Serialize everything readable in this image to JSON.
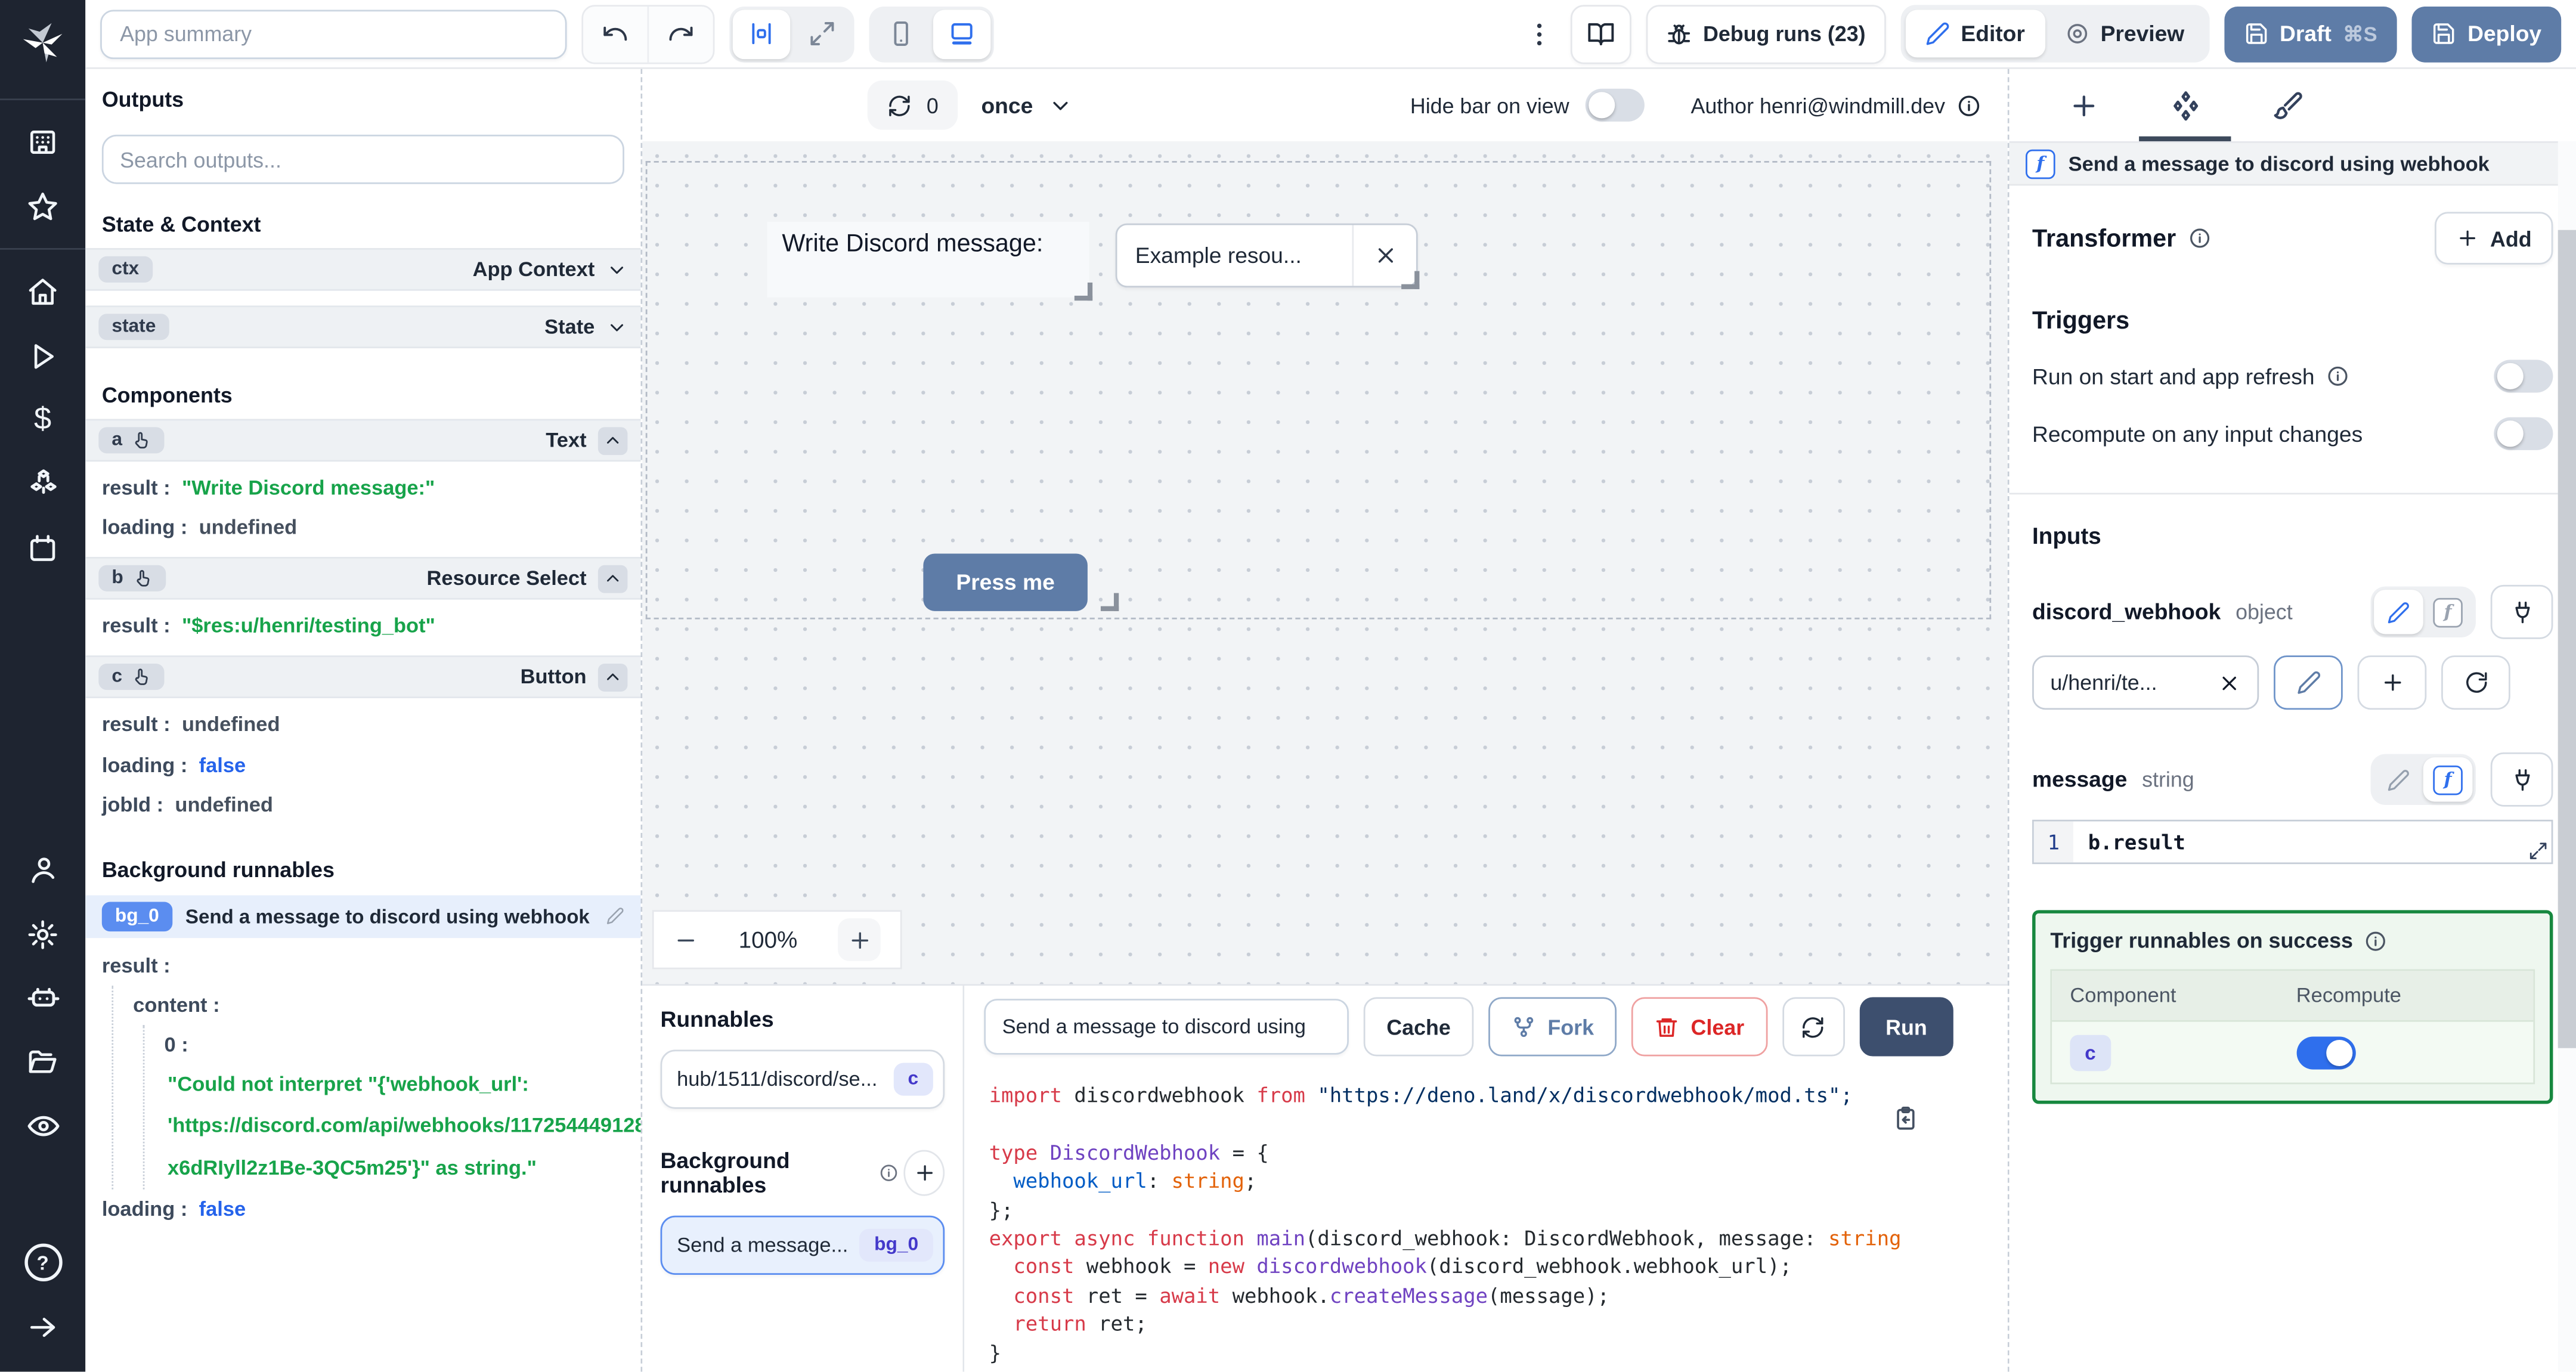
{
  "topbar": {
    "app_summary_placeholder": "App summary",
    "debug_runs_label": "Debug runs (23)",
    "editor_label": "Editor",
    "preview_label": "Preview",
    "draft_label": "Draft",
    "draft_shortcut": "⌘S",
    "deploy_label": "Deploy"
  },
  "rail_icons": {
    "dollar_glyph": "$",
    "help_glyph": "?"
  },
  "canvas_bar": {
    "refresh_count": "0",
    "refresh_mode": "once",
    "hide_bar_label": "Hide bar on view",
    "author_label": "Author henri@windmill.dev"
  },
  "outputs": {
    "title": "Outputs",
    "search_placeholder": "Search outputs...",
    "state_context_title": "State & Context",
    "ctx": {
      "id": "ctx",
      "type": "App Context"
    },
    "state": {
      "id": "state",
      "type": "State"
    },
    "components_title": "Components",
    "a": {
      "id": "a",
      "type": "Text",
      "result_key": "result",
      "result": "\"Write Discord message:\"",
      "loading_key": "loading",
      "loading": "undefined"
    },
    "b": {
      "id": "b",
      "type": "Resource Select",
      "result_key": "result",
      "result": "\"$res:u/henri/testing_bot\""
    },
    "c": {
      "id": "c",
      "type": "Button",
      "result_key": "result",
      "result": "undefined",
      "loading_key": "loading",
      "loading": "false",
      "jobid_key": "jobId",
      "jobid": "undefined"
    },
    "background_title": "Background runnables",
    "bg": {
      "id": "bg_0",
      "name": "Send a message to discord using webhook",
      "result_key": "result",
      "content_key": "content",
      "index_key": "0",
      "error_line1": "\"Could not interpret \"{'webhook_url':",
      "error_line2": "'https://discord.com/api/webhooks/117254449128",
      "error_line3": "x6dRIyll2z1Be-3QC5m25'}\" as string.\"",
      "loading_key": "loading",
      "loading": "false"
    }
  },
  "canvas": {
    "text_component": "Write Discord message:",
    "select_value": "Example resou...",
    "button_label": "Press me",
    "zoom_level": "100%"
  },
  "runnables": {
    "title": "Runnables",
    "item_path": "hub/1511/discord/se...",
    "item_badge": "c",
    "background_title": "Background runnables",
    "bg_item_name": "Send a message...",
    "bg_item_badge": "bg_0"
  },
  "editor": {
    "name_value": "Send a message to discord using",
    "cache_label": "Cache",
    "fork_label": "Fork",
    "clear_label": "Clear",
    "run_label": "Run",
    "code": {
      "lines": [
        [
          [
            "import",
            "kw"
          ],
          [
            " discordwebhook ",
            "pl"
          ],
          [
            "from",
            "kw"
          ],
          [
            " ",
            "pl"
          ],
          [
            "\"https://deno.land/x/discordwebhook/mod.ts\";",
            "str"
          ]
        ],
        [],
        [
          [
            "type",
            "kw"
          ],
          [
            " ",
            "pl"
          ],
          [
            "DiscordWebhook",
            "type"
          ],
          [
            " = {",
            "pl"
          ]
        ],
        [
          [
            "  ",
            "pl"
          ],
          [
            "webhook_url",
            "prop"
          ],
          [
            ": ",
            "pl"
          ],
          [
            "string",
            "orn"
          ],
          [
            ";",
            "pl"
          ]
        ],
        [
          [
            "};",
            "pl"
          ]
        ],
        [
          [
            "export",
            "kw"
          ],
          [
            " ",
            "pl"
          ],
          [
            "async",
            "kw"
          ],
          [
            " ",
            "pl"
          ],
          [
            "function",
            "kw"
          ],
          [
            " ",
            "pl"
          ],
          [
            "main",
            "fn"
          ],
          [
            "(discord_webhook: DiscordWebhook, message: ",
            "pl"
          ],
          [
            "string",
            "orn"
          ]
        ],
        [
          [
            "  ",
            "pl"
          ],
          [
            "const",
            "kw"
          ],
          [
            " webhook = ",
            "pl"
          ],
          [
            "new",
            "kw"
          ],
          [
            " ",
            "pl"
          ],
          [
            "discordwebhook",
            "fn"
          ],
          [
            "(discord_webhook.webhook_url);",
            "pl"
          ]
        ],
        [
          [
            "  ",
            "pl"
          ],
          [
            "const",
            "kw"
          ],
          [
            " ret = ",
            "pl"
          ],
          [
            "await",
            "kw"
          ],
          [
            " webhook.",
            "pl"
          ],
          [
            "createMessage",
            "fn"
          ],
          [
            "(message);",
            "pl"
          ]
        ],
        [
          [
            "  ",
            "pl"
          ],
          [
            "return",
            "kw"
          ],
          [
            " ret;",
            "pl"
          ]
        ],
        [
          [
            "}",
            "pl"
          ]
        ]
      ]
    }
  },
  "right_panel": {
    "header_title": "Send a message to discord using webhook",
    "f_glyph": "f",
    "transformer_title": "Transformer",
    "add_label": "Add",
    "triggers_title": "Triggers",
    "trigger_run_on_start": "Run on start and app refresh",
    "trigger_recompute": "Recompute on any input changes",
    "inputs_title": "Inputs",
    "field1": {
      "name": "discord_webhook",
      "type": "object",
      "select_value": "u/henri/te..."
    },
    "field2": {
      "name": "message",
      "type": "string",
      "line_number": "1",
      "code_value": "b.result"
    },
    "success": {
      "title": "Trigger runnables on success",
      "col_component": "Component",
      "col_recompute": "Recompute",
      "row_id": "c"
    }
  },
  "colors": {
    "slate_button": "#5e7ca7",
    "run_button": "#3d4f6e",
    "accent_blue": "#2f6fed",
    "green_text": "#17a34a",
    "value_blue": "#2563eb",
    "success_border": "#17883f",
    "bg0_chip": "#5b8df0"
  }
}
